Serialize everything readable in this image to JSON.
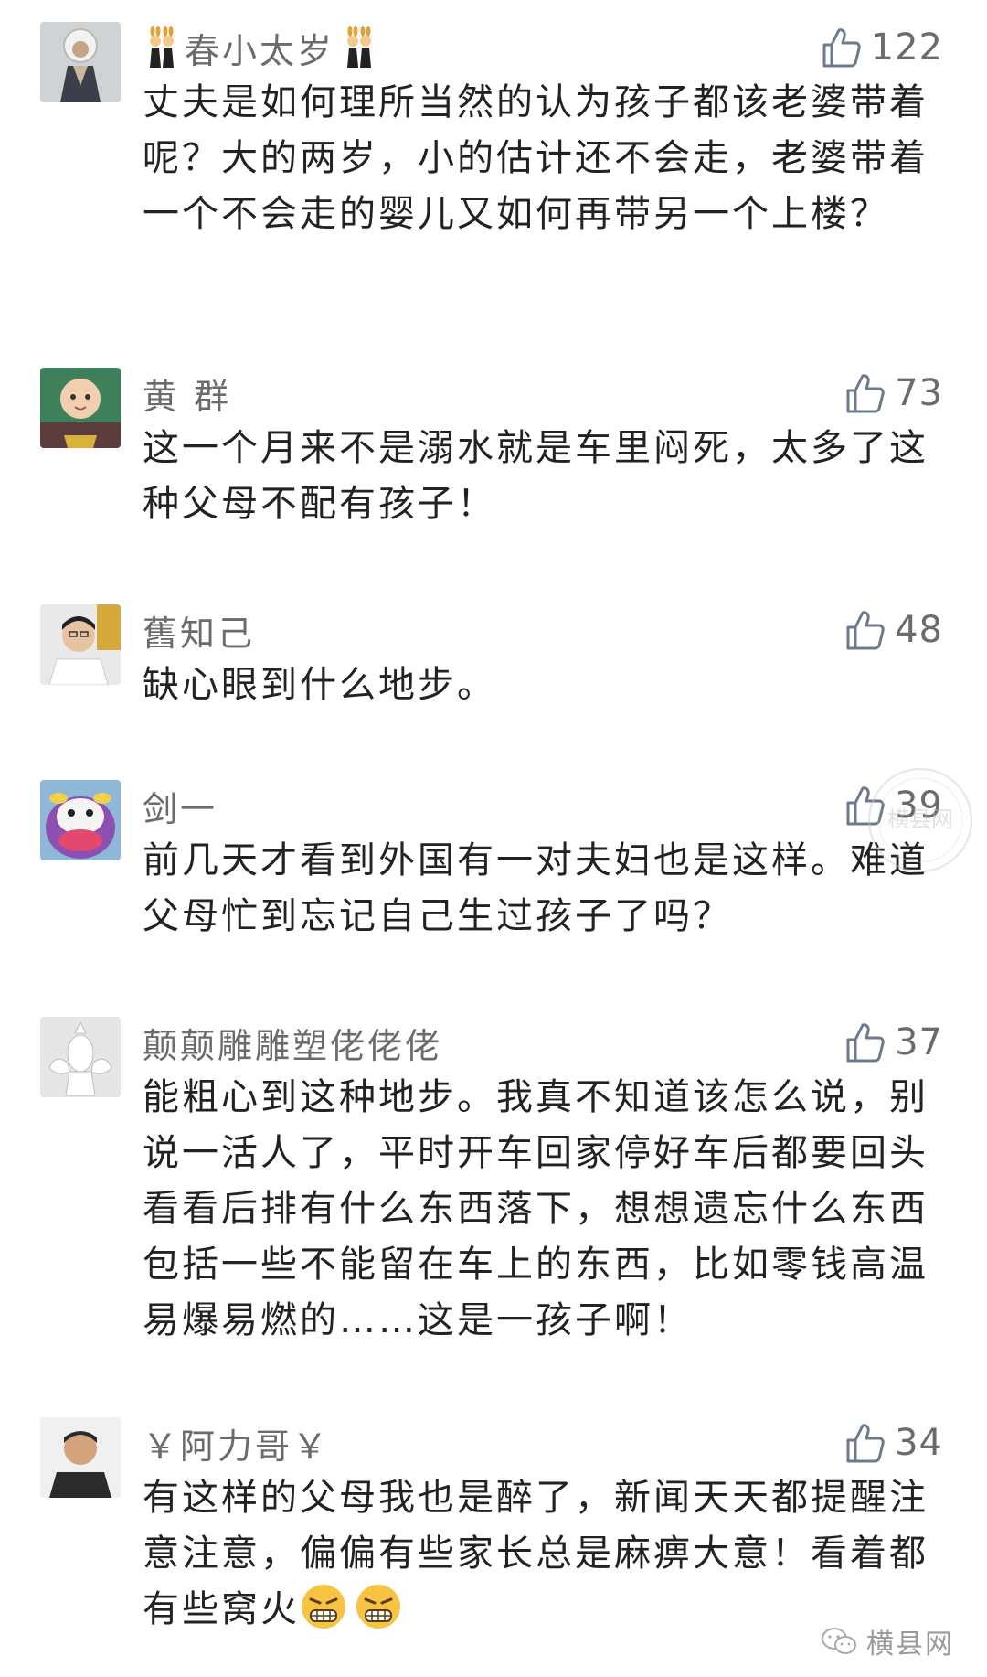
{
  "comments": [
    {
      "user": "春小太岁",
      "likes": "122",
      "text": "丈夫是如何理所当然的认为孩子都该老婆带着呢？大的两岁，小的估计还不会走，老婆带着一个不会走的婴儿又如何再带另一个上楼？"
    },
    {
      "user": "黄 群",
      "likes": "73",
      "text": "这一个月来不是溺水就是车里闷死，太多了这种父母不配有孩子！"
    },
    {
      "user": "舊知己",
      "likes": "48",
      "text": "缺心眼到什么地步。"
    },
    {
      "user": "剑一",
      "likes": "39",
      "text": "前几天才看到外国有一对夫妇也是这样。难道父母忙到忘记自己生过孩子了吗？"
    },
    {
      "user": "颠颠雕雕塑佬佬佬",
      "likes": "37",
      "text": "能粗心到这种地步。我真不知道该怎么说，别说一活人了，平时开车回家停好车后都要回头看看后排有什么东西落下，想想遗忘什么东西包括一些不能留在车上的东西，比如零钱高温易爆易燃的……这是一孩子啊！"
    },
    {
      "user": "￥阿力哥￥",
      "likes": "34",
      "text": "有这样的父母我也是醉了，新闻天天都提醒注意注意，偏偏有些家长总是麻痹大意！看着都有些窝火"
    }
  ],
  "watermark": {
    "stamp_text": "横县网",
    "footer_text": "横县网"
  },
  "icons": {
    "like": "thumbs-up-icon",
    "badge": "bunny-girls-icon",
    "emoji": "grimacing-face-emoji",
    "footer": "wechat-icon"
  },
  "colors": {
    "text": "#222222",
    "meta": "#6b6b6b",
    "background": "#ffffff"
  }
}
